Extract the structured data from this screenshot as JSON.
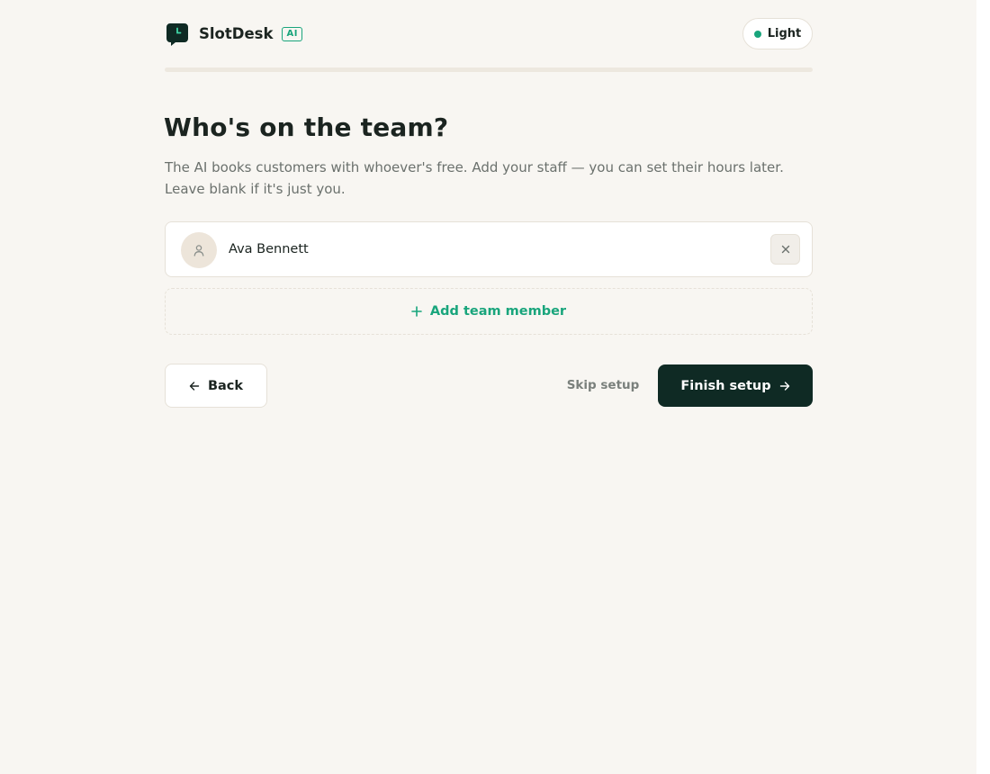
{
  "header": {
    "brand_name": "SlotDesk",
    "badge": "AI",
    "theme_toggle_label": "Light"
  },
  "progress": {
    "fraction": 1.0
  },
  "step": {
    "title": "Who's on the team?",
    "description": "The AI books customers with whoever's free. Add your staff — you can set their hours later. Leave blank if it's just you."
  },
  "team_members": [
    {
      "name": "Ava Bennett"
    }
  ],
  "actions": {
    "add_member_label": "Add team member",
    "back_label": "Back",
    "skip_label": "Skip setup",
    "finish_label": "Finish setup"
  },
  "colors": {
    "background": "#f8f6f2",
    "accent": "#19a57c",
    "primary_button": "#0f2a24",
    "text": "#1b2420"
  }
}
